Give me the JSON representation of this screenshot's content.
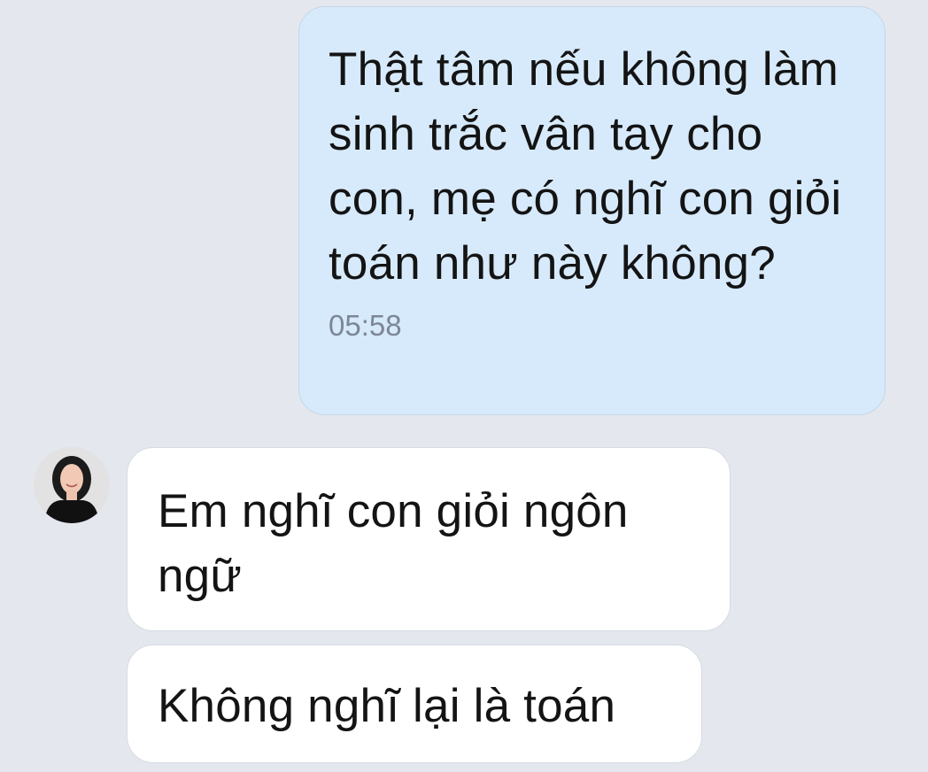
{
  "messages": {
    "sent": {
      "text": "Thật tâm nếu không làm sinh trắc vân tay cho con, mẹ có nghĩ con giỏi toán như này không?",
      "time": "05:58"
    },
    "received": [
      {
        "text": "Em nghĩ con giỏi ngôn ngữ"
      },
      {
        "text": "Không nghĩ lại là toán"
      }
    ]
  },
  "colors": {
    "background": "#e4e8ee",
    "sent_bubble": "#d7eafb",
    "received_bubble": "#ffffff",
    "timestamp": "#7c8795"
  },
  "icons": {
    "contact_avatar": "avatar"
  }
}
